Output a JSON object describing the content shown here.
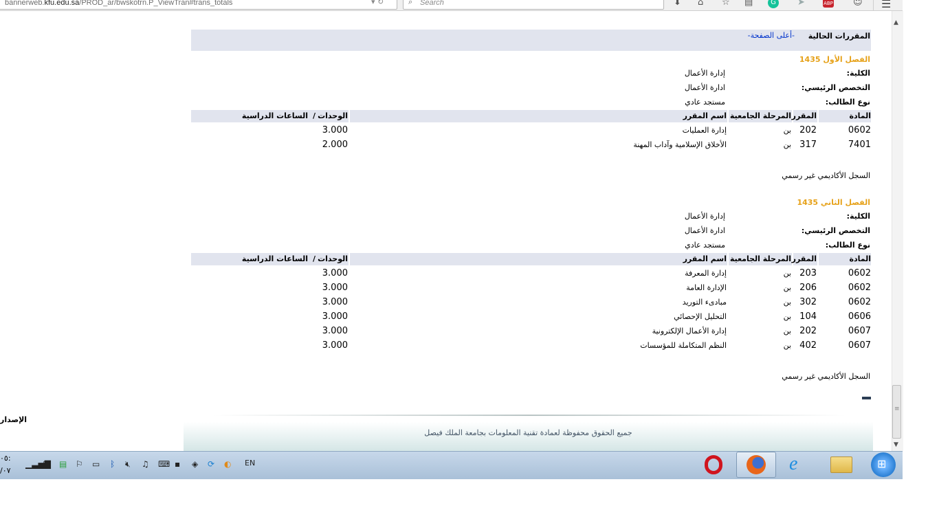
{
  "browser": {
    "url_host_pre": "bannerweb.",
    "url_host_bold": "kfu.edu.sa",
    "url_path": "/PROD_ar/bwskotrn.P_ViewTran#trans_totals",
    "search_placeholder": "Search",
    "icons": [
      "download-icon",
      "home-icon",
      "bookmark-star-icon",
      "library-icon",
      "grammarly-icon",
      "send-icon",
      "adblock-icon",
      "emoji-icon",
      "menu-icon"
    ]
  },
  "page": {
    "section_title": "المقررات الحالية",
    "top_link": "-أعلى الصفحة-",
    "labels": {
      "college": "الكلية:",
      "major": "التخصص الرئيسي:",
      "student_type": "نوع الطالب:"
    },
    "columns": {
      "subject": "المادة",
      "course": "المقرر",
      "level": "المرحلة الجامعية",
      "title": "اسم المقرر",
      "units": "الوحدات",
      "sep": "/",
      "hours": "الساعات الدراسية"
    },
    "terms": [
      {
        "name": "الفصل الأول 1435",
        "college": "إدارة الأعمال",
        "major": "ادارة الأعمال",
        "student_type": "مستجد عادي",
        "rows": [
          {
            "subject": "0602",
            "course": "202",
            "level": "بن",
            "title": "إدارة العمليات",
            "units": "3.000"
          },
          {
            "subject": "7401",
            "course": "317",
            "level": "بن",
            "title": "الأخلاق الإسلامية وآداب المهنة",
            "units": "2.000"
          }
        ],
        "note": "السجل الأكاديمي غير رسمي"
      },
      {
        "name": "الفصل الثاني 1435",
        "college": "إدارة الأعمال",
        "major": "ادارة الأعمال",
        "student_type": "مستجد عادي",
        "rows": [
          {
            "subject": "0602",
            "course": "203",
            "level": "بن",
            "title": "إدارة المعرفة",
            "units": "3.000"
          },
          {
            "subject": "0602",
            "course": "206",
            "level": "بن",
            "title": "الإدارة العامة",
            "units": "3.000"
          },
          {
            "subject": "0602",
            "course": "302",
            "level": "بن",
            "title": "مبادىء التوريد",
            "units": "3.000"
          },
          {
            "subject": "0606",
            "course": "104",
            "level": "بن",
            "title": "التحليل الإحصائي",
            "units": "3.000"
          },
          {
            "subject": "0607",
            "course": "202",
            "level": "بن",
            "title": "إدارة الأعمال الإلكترونية",
            "units": "3.000"
          },
          {
            "subject": "0607",
            "course": "402",
            "level": "بن",
            "title": "النظم المتكاملة للمؤسسات",
            "units": "3.000"
          }
        ],
        "note": "السجل الأكاديمي غير رسمي"
      }
    ],
    "footer": "جميع الحقوق محفوظة لعمادة تقنية المعلومات بجامعة الملك فيصل",
    "edition_label": "الإصدار"
  },
  "taskbar": {
    "lang": "EN",
    "clock_time": "٠٥:",
    "clock_date": "/٠٧",
    "colors": {
      "opera": "#d0141e",
      "firefox": "#e8661b",
      "ie": "#1e8ee0",
      "explorer": "#e9c65a",
      "start": "#2a7fd4"
    }
  }
}
